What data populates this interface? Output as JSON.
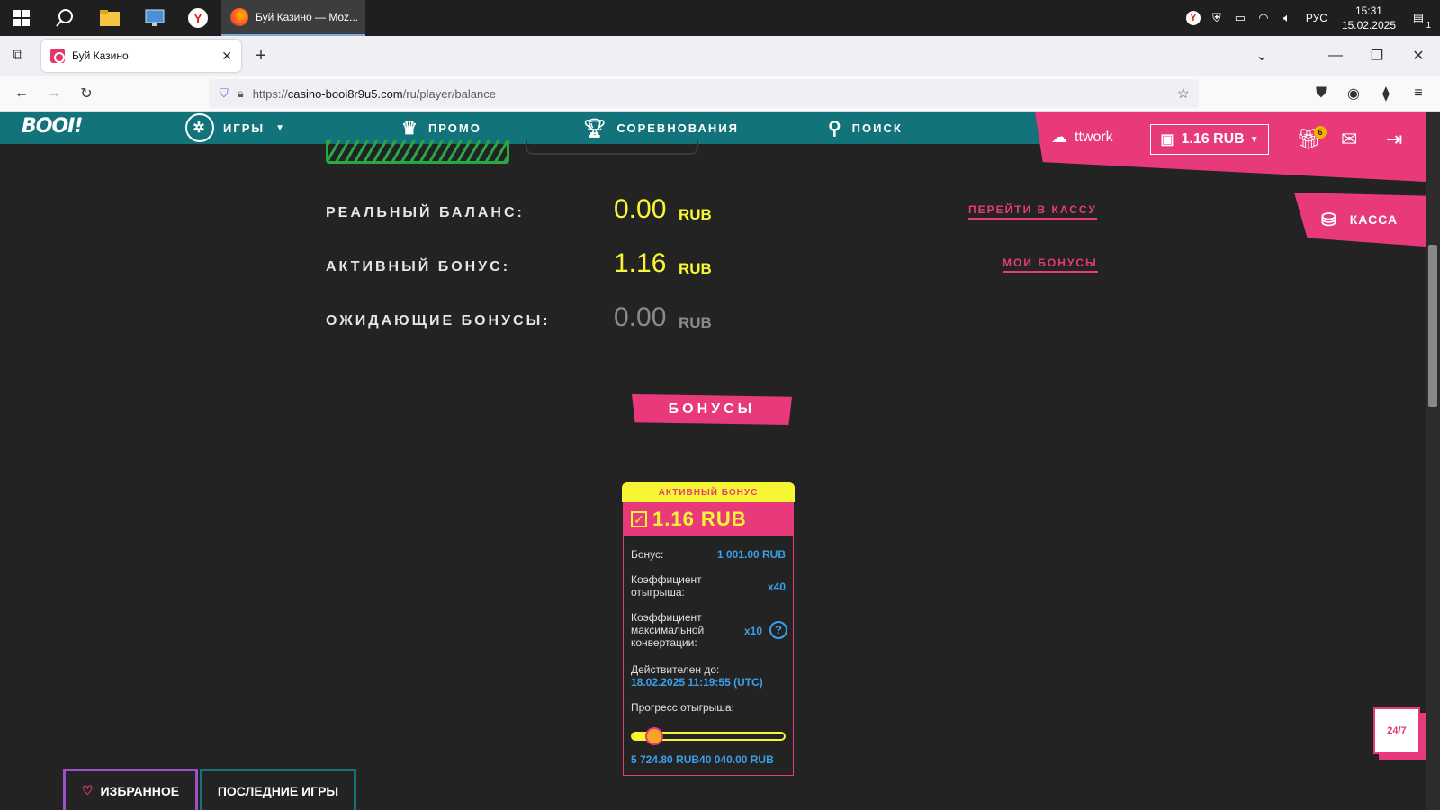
{
  "taskbar": {
    "app_title": "Буй Казино — Moz...",
    "lang": "РУС",
    "time": "15:31",
    "date": "15.02.2025",
    "notif_count": "1"
  },
  "browser": {
    "tab_title": "Буй Казино",
    "url_prefix": "https://",
    "url_host": "casino-booi8r9u5.com",
    "url_path": "/ru/player/balance"
  },
  "site": {
    "logo": "BOOI!",
    "nav": {
      "games": "ИГРЫ",
      "promo": "ПРОМО",
      "competitions": "СОРЕВНОВАНИЯ",
      "search": "ПОИСК"
    },
    "username": "ttwork",
    "balance": "1.16 RUB",
    "gift_badge": "6",
    "kassa": "КАССА"
  },
  "balances": [
    {
      "label": "РЕАЛЬНЫЙ БАЛАНС:",
      "value": "0.00",
      "currency": "RUB",
      "link": "ПЕРЕЙТИ В КАССУ"
    },
    {
      "label": "АКТИВНЫЙ БОНУС:",
      "value": "1.16",
      "currency": "RUB",
      "link": "МОИ БОНУСЫ"
    },
    {
      "label": "ОЖИДАЮЩИЕ БОНУСЫ:",
      "value": "0.00",
      "currency": "RUB"
    }
  ],
  "bonuses_button": "БОНУСЫ",
  "bonus_card": {
    "tag": "АКТИВНЫЙ БОНУС",
    "amount": "1.16 RUB",
    "bonus_label": "Бонус:",
    "bonus_value": "1 001.00 RUB",
    "wager_label": "Коэффициент отыгрыша:",
    "wager_value": "x40",
    "maxconv_label": "Коэффициент максимальной конвертации:",
    "maxconv_value": "x10",
    "valid_label": "Действителен до:",
    "valid_value": "18.02.2025 11:19:55 (UTC)",
    "progress_label": "Прогресс отыгрыша:",
    "progress_fraction": 0.14,
    "progress_current": "5 724.80 RUB",
    "progress_target": "40 040.00 RUB"
  },
  "bottom_tabs": {
    "favorites": "ИЗБРАННОЕ",
    "recent": "ПОСЛЕДНИЕ ИГРЫ"
  },
  "support": "24/7",
  "colors": {
    "brand_pink": "#e83a7b",
    "teal": "#12747a",
    "yellow": "#f6f635",
    "link_blue": "#3aa0e8"
  }
}
